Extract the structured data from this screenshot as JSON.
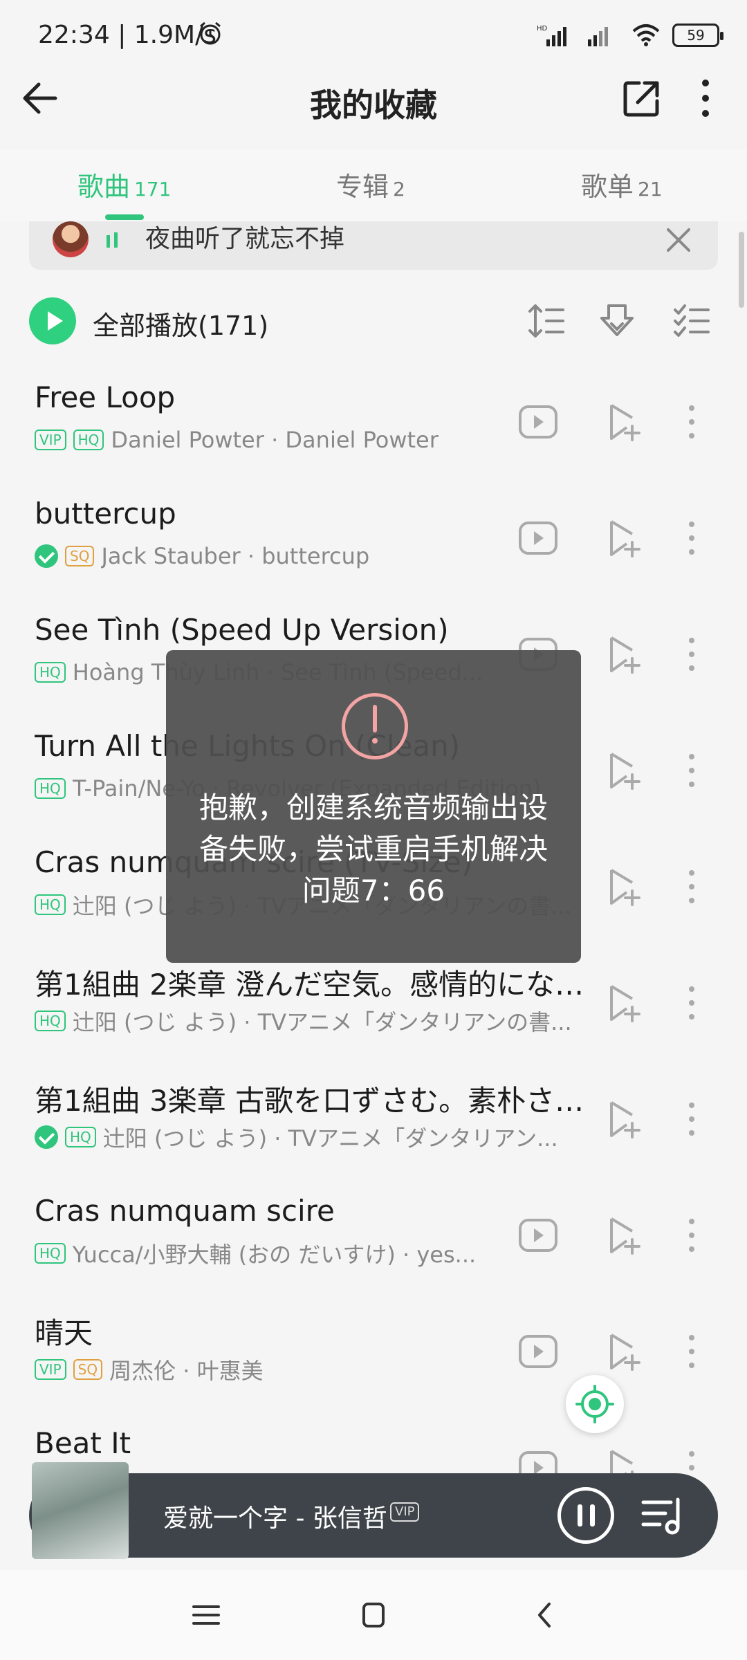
{
  "status_bar": {
    "time": "22:34 | 1.9M/s",
    "battery": "59",
    "network_label": "HD"
  },
  "app_bar": {
    "title": "我的收藏"
  },
  "tabs": [
    {
      "label": "歌曲",
      "count": "171",
      "active": true
    },
    {
      "label": "专辑",
      "count": "2",
      "active": false
    },
    {
      "label": "歌单",
      "count": "21",
      "active": false
    }
  ],
  "now_playing_hint": {
    "text": "夜曲听了就忘不掉"
  },
  "play_all": {
    "label": "全部播放(171)"
  },
  "songs": [
    {
      "title": "Free Loop",
      "badges": [
        "VIP",
        "HQ"
      ],
      "downloaded": false,
      "artist": "Daniel Powter · Daniel Powter"
    },
    {
      "title": "buttercup",
      "badges": [
        "SQ"
      ],
      "downloaded": true,
      "artist": "Jack Stauber · buttercup"
    },
    {
      "title": "See Tình (Speed Up Version)",
      "badges": [
        "HQ"
      ],
      "downloaded": false,
      "artist": "Hoàng Thùy Linh · See Tình (Speed..."
    },
    {
      "title": "Turn All the Lights On (Clean)",
      "badges": [
        "HQ"
      ],
      "downloaded": false,
      "artist": "T-Pain/Ne-Yo · Revolver (Expanded Edition)"
    },
    {
      "title": "Cras numquam scire (TV-Size)",
      "badges": [
        "HQ"
      ],
      "downloaded": false,
      "artist": "辻阳 (つじ よう) · TVアニメ「ダンタリアンの書..."
    },
    {
      "title": "第1組曲 2楽章 澄んだ空気。感情的になり...",
      "badges": [
        "HQ"
      ],
      "downloaded": false,
      "artist": "辻阳 (つじ よう) · TVアニメ「ダンタリアンの書..."
    },
    {
      "title": "第1組曲 3楽章 古歌を口ずさむ。素朴さと...",
      "badges": [
        "HQ"
      ],
      "downloaded": true,
      "artist": "辻阳 (つじ よう) · TVアニメ「ダンタリアン..."
    },
    {
      "title": "Cras numquam scire",
      "badges": [
        "HQ"
      ],
      "downloaded": false,
      "artist": "Yucca/小野大輔 (おの だいすけ) · yes..."
    },
    {
      "title": "晴天",
      "badges": [
        "VIP",
        "SQ"
      ],
      "downloaded": false,
      "artist": "周杰伦 · 叶惠美"
    },
    {
      "title": "Beat It",
      "badges": [],
      "downloaded": false,
      "artist": ""
    }
  ],
  "toast": {
    "message": "抱歉，创建系统音频输出设备失败，尝试重启手机解决问题7：66"
  },
  "mini_player": {
    "title": "爱就一个字 - 张信哲",
    "badge": "VIP"
  },
  "colors": {
    "accent": "#2fc57c",
    "sq_badge": "#e0a040",
    "toast_bg": "#505050",
    "error_icon": "#f3a4a4",
    "mini_player_bg": "#3e4449"
  },
  "icons": {
    "back": "arrow-left-icon",
    "share": "share-icon",
    "more": "more-vertical-icon",
    "close": "close-icon",
    "sort": "sort-icon",
    "download": "download-icon",
    "multi_select": "multi-select-icon",
    "video": "video-play-icon",
    "add_to_playlist": "add-to-playlist-icon",
    "locate": "locate-icon",
    "pause": "pause-icon",
    "playlist": "playlist-icon"
  }
}
